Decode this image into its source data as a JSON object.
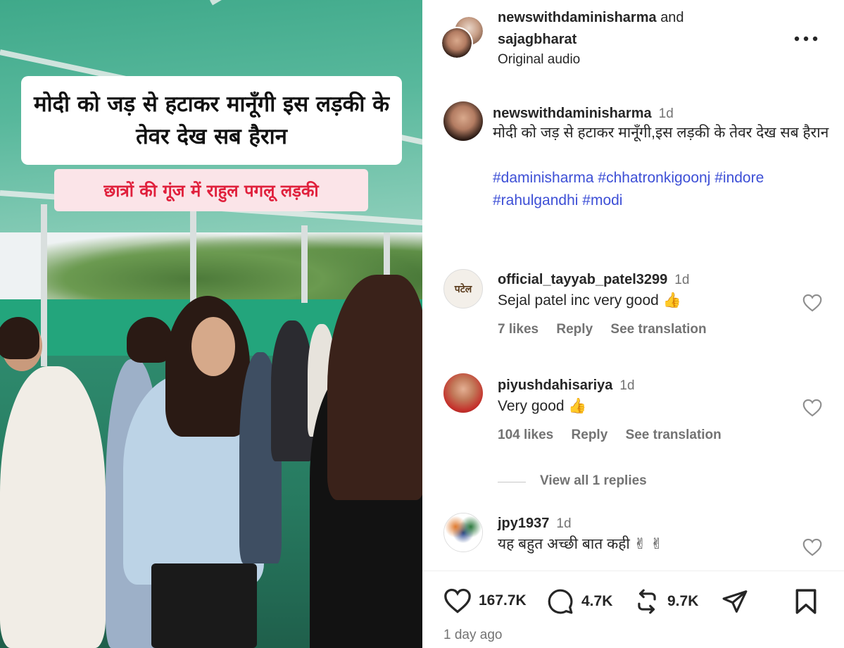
{
  "media": {
    "caption_main": "मोदी को जड़ से हटाकर मानूँगी इस लड़की के तेवर देख सब हैरान",
    "caption_sub": "छात्रों की गूंज में राहुल पगलू लड़की"
  },
  "header": {
    "user1": "newswithdaminisharma",
    "and_text": "and",
    "user2": "sajagbharat",
    "audio": "Original audio",
    "more_icon": "more-horizontal-icon"
  },
  "caption_comment": {
    "user": "newswithdaminisharma",
    "time": "1d",
    "text": "मोदी को जड़ से हटाकर मानूँगी,इस लड़की के तेवर देख सब हैरान",
    "hashtags": [
      "#daminisharma",
      "#chhatronkigoonj",
      "#indore",
      "#rahulgandhi",
      "#modi"
    ]
  },
  "comments": [
    {
      "user": "official_tayyab_patel3299",
      "time": "1d",
      "text": "Sejal patel inc very good 👍",
      "likes": "7 likes",
      "reply": "Reply",
      "translate": "See translation",
      "avatar_text": "पटेल"
    },
    {
      "user": "piyushdahisariya",
      "time": "1d",
      "text": "Very good 👍",
      "likes": "104 likes",
      "reply": "Reply",
      "translate": "See translation",
      "view_replies": "View all 1 replies"
    },
    {
      "user": "jpy1937",
      "time": "1d",
      "text": "यह बहुत अच्छी बात कही ✌ ✌"
    }
  ],
  "actions": {
    "likes": "167.7K",
    "comments": "4.7K",
    "reposts": "9.7K",
    "posted": "1 day ago"
  },
  "colors": {
    "hashtag": "#3d4fd6",
    "caption_sub_text": "#e0203c",
    "caption_sub_bg": "#fbe4e8"
  }
}
